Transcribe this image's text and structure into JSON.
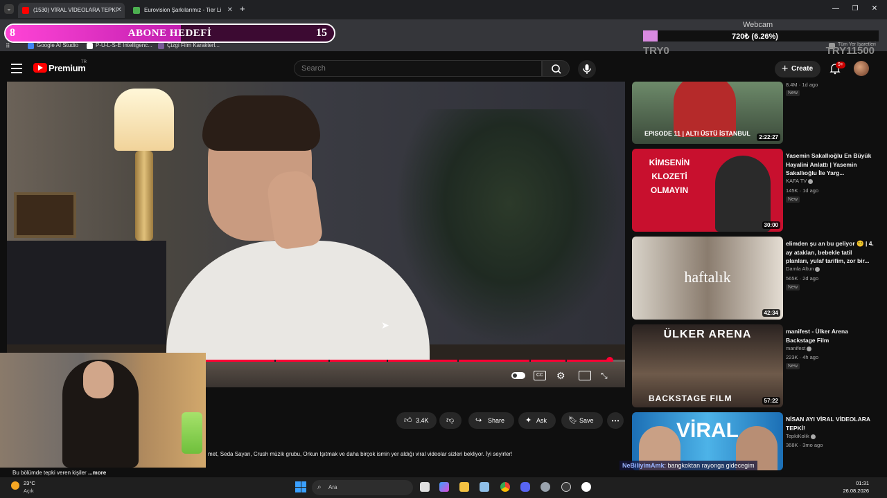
{
  "browser": {
    "tabs": [
      {
        "label": "(1530) VİRAL VİDEOLARA TEPKİ",
        "active": true
      },
      {
        "label": "Eurovision Şarkılarımız - Tier Li",
        "active": false
      }
    ],
    "new_tab_symbol": "+",
    "bookmarks": [
      "Google AI Studio",
      "P-U-L-S-E Intelligenc...",
      "Çizgi Film Karakterl..."
    ],
    "other_bookmarks": "Tüm Yer İşaretleri"
  },
  "stream_overlay": {
    "goal": {
      "current": "8",
      "title": "ABONE HEDEFİ",
      "target": "15",
      "fill_fraction": 0.533
    },
    "webcam_label": "Webcam",
    "try_amount": "720₺ (6.26%)",
    "try_fraction": 0.0626,
    "try_start": "TRY0",
    "try_goal": "TRY11500"
  },
  "youtube": {
    "brand": "Premium",
    "country": "TR",
    "search_placeholder": "Search",
    "create_label": "Create",
    "notification_badge": "9+"
  },
  "player": {
    "progress_fraction": 0.975
  },
  "actions": {
    "likes": "3.4K",
    "share": "Share",
    "ask": "Ask",
    "save": "Save"
  },
  "description": {
    "line": "met, Seda Sayan, Crush müzik grubu, Orkun Işıtmak ve daha birçok ismin yer aldığı viral videolar sizleri bekliyor. İyi seyirler!",
    "start": "Bu bölümde tepki veren kişiler",
    "more": "...more"
  },
  "recommendations": [
    {
      "thumb_text": "EPISODE 11 | ALTI ÜSTÜ İSTANBUL",
      "duration": "2:22:27",
      "title": "",
      "channel": "",
      "meta": "8.4M · 1d ago",
      "badge": "New"
    },
    {
      "thumb_text": "KİMSENİN KLOZETİ OLMAYIN",
      "duration": "30:00",
      "title": "Yasemin Sakallıoğlu En Büyük Hayalini Anlattı | Yasemin Sakallıoğlu İle Yarg...",
      "channel": "KAFA TV",
      "meta": "145K · 1d ago",
      "badge": "New"
    },
    {
      "thumb_text": "haftalık",
      "duration": "42:34",
      "title": "elimden şu an bu geliyor 😵‍💫 | 4. ay atakları, bebekle tatil planları, yulaf tarifim, zor bir...",
      "channel": "Damla Altun",
      "meta": "565K · 2d ago",
      "badge": "New"
    },
    {
      "thumb_text": "ÜLKER ARENA",
      "thumb_text_2": "BACKSTAGE FILM",
      "duration": "57:22",
      "title": "manifest - Ülker Arena Backstage Film",
      "channel": "manifest",
      "meta": "223K · 4h ago",
      "badge": "New"
    },
    {
      "thumb_text": "VİRAL",
      "duration": "",
      "title": "NİSAN AYI VİRAL VİDEOLARA TEPKİ!",
      "channel": "TepkiKolik",
      "meta": "368K · 3mo ago",
      "badge": ""
    }
  ],
  "chat": {
    "user": "NeBiliyimAmk",
    "message": ": bangkoktan rayonga gidecegim"
  },
  "taskbar": {
    "temp": "23°C",
    "weather": "Açık",
    "search_label": "Ara",
    "time": "01:31",
    "date": "26.08.2026"
  },
  "colors": {
    "accent": "#ff0033",
    "goal": "#ff44d6",
    "try_fill": "#d98ae0"
  }
}
